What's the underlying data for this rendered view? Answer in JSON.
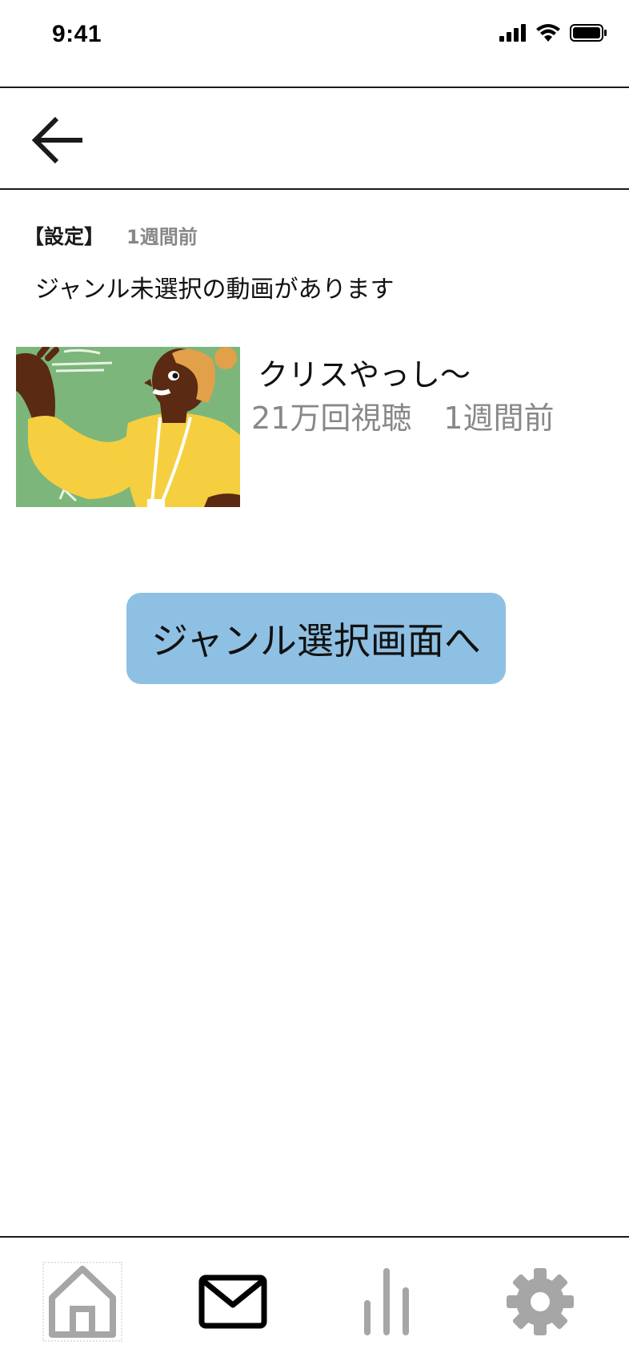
{
  "status_bar": {
    "time": "9:41",
    "icons": [
      "signal-icon",
      "wifi-icon",
      "battery-icon"
    ]
  },
  "header": {
    "back_icon": "arrow-left-icon"
  },
  "notice": {
    "category": "【設定】",
    "time": "1週間前",
    "message": "ジャンル未選択の動画があります"
  },
  "video": {
    "title": "クリスやっし〜",
    "views": "21万回視聴",
    "time": "1週間前"
  },
  "cta": {
    "label": "ジャンル選択画面へ"
  },
  "tab_bar": {
    "tabs": [
      {
        "icon": "home-icon",
        "active": false
      },
      {
        "icon": "mail-icon",
        "active": true
      },
      {
        "icon": "chart-icon",
        "active": false
      },
      {
        "icon": "gear-icon",
        "active": false
      }
    ]
  },
  "colors": {
    "button_bg": "#8ec0e3",
    "muted_text": "#888888",
    "inactive_icon": "#a6a6a6",
    "active_icon": "#000000",
    "thumbnail_bg": "#7db67a"
  }
}
